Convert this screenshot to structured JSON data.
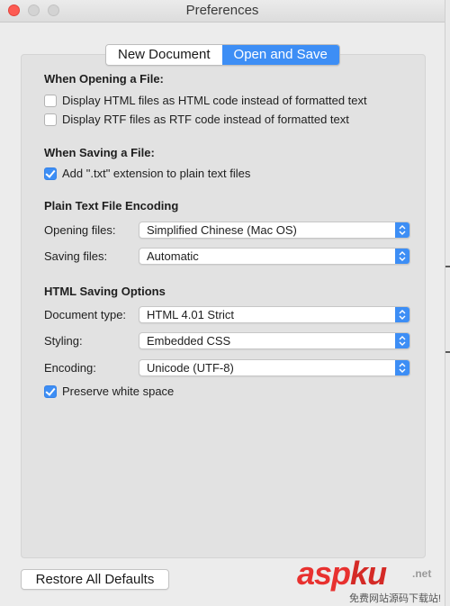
{
  "window": {
    "title": "Preferences"
  },
  "tabs": [
    {
      "label": "New Document",
      "active": false
    },
    {
      "label": "Open and Save",
      "active": true
    }
  ],
  "opening": {
    "heading": "When Opening a File:",
    "options": [
      {
        "label": "Display HTML files as HTML code instead of formatted text",
        "checked": false
      },
      {
        "label": "Display RTF files as RTF code instead of formatted text",
        "checked": false
      }
    ]
  },
  "saving": {
    "heading": "When Saving a File:",
    "options": [
      {
        "label": "Add \".txt\" extension to plain text files",
        "checked": true
      }
    ]
  },
  "encoding": {
    "heading": "Plain Text File Encoding",
    "opening_label": "Opening files:",
    "opening_value": "Simplified Chinese (Mac OS)",
    "saving_label": "Saving files:",
    "saving_value": "Automatic"
  },
  "html_saving": {
    "heading": "HTML Saving Options",
    "doctype_label": "Document type:",
    "doctype_value": "HTML 4.01 Strict",
    "styling_label": "Styling:",
    "styling_value": "Embedded CSS",
    "encoding_label": "Encoding:",
    "encoding_value": "Unicode (UTF-8)",
    "preserve_label": "Preserve white space",
    "preserve_checked": true
  },
  "footer": {
    "restore_label": "Restore All Defaults"
  },
  "watermark": {
    "logo_a": "asp",
    "logo_b": "ku",
    "suffix": ".net",
    "subtitle": "免费网站源码下载站!"
  },
  "colors": {
    "accent": "#3d8ef5",
    "close": "#fd5b53",
    "watermark": "#e8312f"
  }
}
